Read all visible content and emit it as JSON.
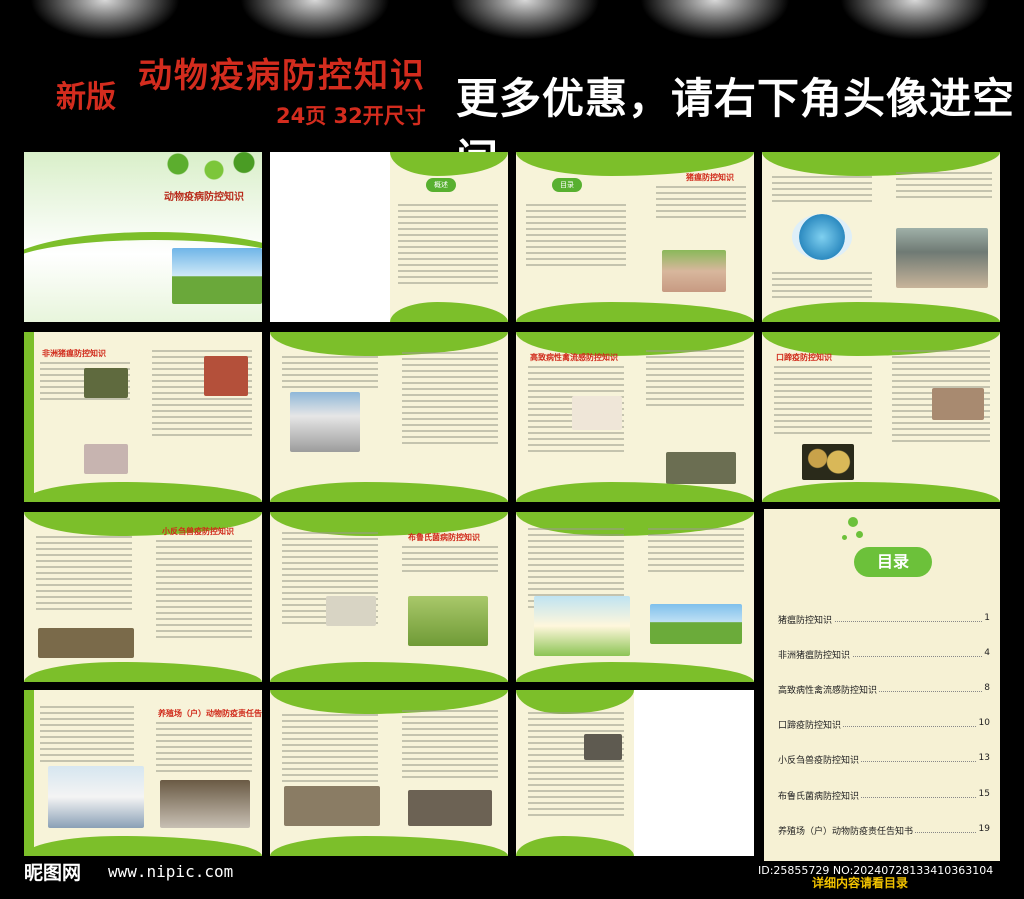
{
  "header": {
    "badge": "新版",
    "title": "动物疫病防控知识",
    "subtitle": "24页  32开尺寸",
    "promo": "更多优惠，请右下角头像进空间"
  },
  "cover": {
    "title": "动物疫病防控知识"
  },
  "pages": {
    "overview_badge": "概述",
    "toc_badge": "目录",
    "swine_fever": "猪瘟防控知识",
    "african_swine_fever": "非洲猪瘟防控知识",
    "avian_flu": "高致病性禽流感防控知识",
    "fmd": "口蹄疫防控知识",
    "ppr": "小反刍兽疫防控知识",
    "brucellosis": "布鲁氏菌病防控知识",
    "notice": "养殖场（户）动物防疫责任告知书"
  },
  "toc": {
    "heading": "目录",
    "items": [
      {
        "label": "猪瘟防控知识",
        "page": "1"
      },
      {
        "label": "非洲猪瘟防控知识",
        "page": "4"
      },
      {
        "label": "高致病性禽流感防控知识",
        "page": "8"
      },
      {
        "label": "口蹄疫防控知识",
        "page": "10"
      },
      {
        "label": "小反刍兽疫防控知识",
        "page": "13"
      },
      {
        "label": "布鲁氏菌病防控知识",
        "page": "15"
      },
      {
        "label": "养殖场（户）动物防疫责任告知书",
        "page": "19"
      }
    ]
  },
  "footer": {
    "brand": "昵图网",
    "site": "www.nipic.com",
    "id": "ID:25855729 NO:20240728133410363104",
    "note": "详细内容请看目录"
  },
  "colors": {
    "accent_green": "#7cbf2a",
    "title_red": "#d32c1e",
    "page_bg": "#f7f3d9"
  }
}
